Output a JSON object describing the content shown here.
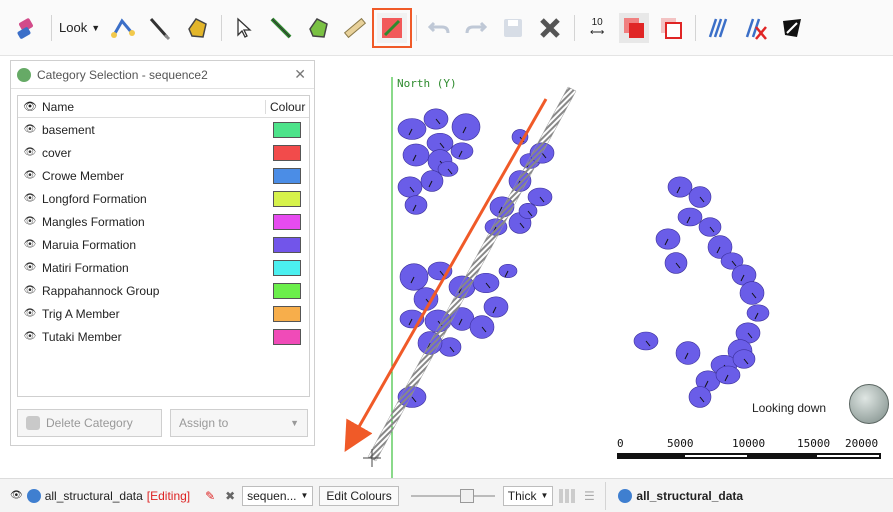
{
  "toolbar": {
    "look_label": "Look",
    "measure_value": "10",
    "buttons": [
      "eraser-icon",
      "look-dropdown",
      "connect-points-icon",
      "draw-line-icon",
      "polygon-icon",
      "select-pointer-icon",
      "draw-polyline-icon",
      "draw-polygon-icon",
      "ruler-icon",
      "assign-category-icon",
      "undo-icon",
      "redo-icon",
      "save-icon",
      "cancel-icon",
      "measure-icon",
      "paint-filled-icon",
      "paint-outline-icon",
      "stripe-hatch-icon",
      "remove-category-icon",
      "lasso-icon"
    ]
  },
  "viewport": {
    "north_label": "North (Y)",
    "looking_down_label": "Looking down",
    "scale": {
      "labels": [
        "0",
        "5000",
        "10000",
        "15000",
        "20000"
      ]
    },
    "disc_color": "#6a5de8",
    "arrow_color": "#f05a28"
  },
  "panel": {
    "title": "Category Selection - sequence2",
    "columns": {
      "name": "Name",
      "colour": "Colour"
    },
    "rows": [
      {
        "name": "basement",
        "color": "#4de38a"
      },
      {
        "name": "cover",
        "color": "#f24b4b"
      },
      {
        "name": "Crowe Member",
        "color": "#4b8de6"
      },
      {
        "name": "Longford Formation",
        "color": "#d6f24b"
      },
      {
        "name": "Mangles Formation",
        "color": "#e64bf0"
      },
      {
        "name": "Maruia Formation",
        "color": "#7255ea"
      },
      {
        "name": "Matiri Formation",
        "color": "#4befef"
      },
      {
        "name": "Rappahannock Group",
        "color": "#6bef4b"
      },
      {
        "name": "Trig A Member",
        "color": "#f7ae4b"
      },
      {
        "name": "Tutaki Member",
        "color": "#f04bb8"
      }
    ],
    "delete_button": "Delete Category",
    "assign_button": "Assign to"
  },
  "statusbar": {
    "object_name": "all_structural_data",
    "editing_label": "[Editing]",
    "sequence_dropdown": "sequen...",
    "edit_colours_button": "Edit Colours",
    "slider_value": 0.7,
    "thickness_dropdown": "Thick",
    "right_object_name": "all_structural_data"
  }
}
